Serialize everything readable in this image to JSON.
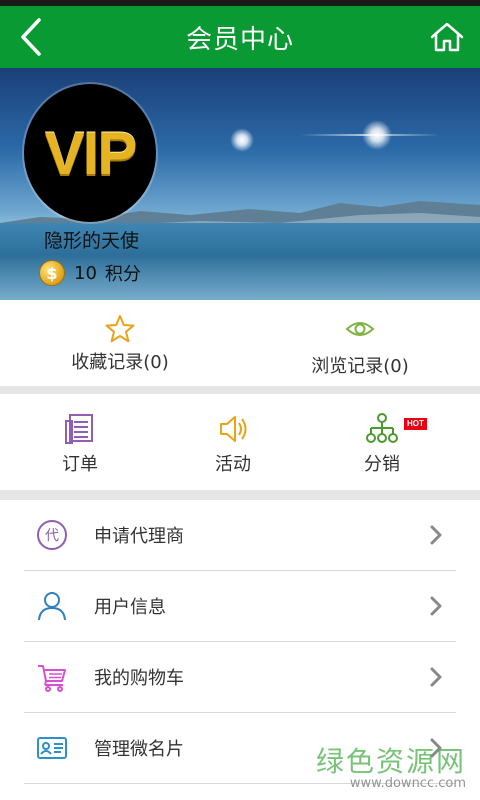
{
  "header": {
    "title": "会员中心"
  },
  "profile": {
    "avatar_text": "VIP",
    "username": "隐形的天使",
    "points_value": "10",
    "points_unit": "积分",
    "coin_symbol": "$"
  },
  "favorites": [
    {
      "label": "收藏记录(0)",
      "icon": "star-icon"
    },
    {
      "label": "浏览记录(0)",
      "icon": "eye-icon"
    }
  ],
  "features": [
    {
      "label": "订单",
      "icon": "order-icon"
    },
    {
      "label": "活动",
      "icon": "speaker-icon"
    },
    {
      "label": "分销",
      "icon": "distribution-icon",
      "badge": "HOT"
    }
  ],
  "menu": [
    {
      "label": "申请代理商",
      "icon": "agent-icon",
      "icon_text": "代"
    },
    {
      "label": "用户信息",
      "icon": "user-icon"
    },
    {
      "label": "我的购物车",
      "icon": "cart-icon"
    },
    {
      "label": "管理微名片",
      "icon": "card-icon"
    }
  ],
  "watermark": {
    "brand": "绿色资源网",
    "url": "www.downcc.com"
  },
  "colors": {
    "header_green": "#0a9a34",
    "star_yellow": "#e8a317",
    "eye_green": "#7cb342",
    "purple": "#8e5fb5",
    "orange": "#e8a317",
    "teal": "#4a9a2f",
    "blue": "#2f7fc1",
    "magenta": "#d94fd1",
    "hot_red": "#e60012"
  }
}
